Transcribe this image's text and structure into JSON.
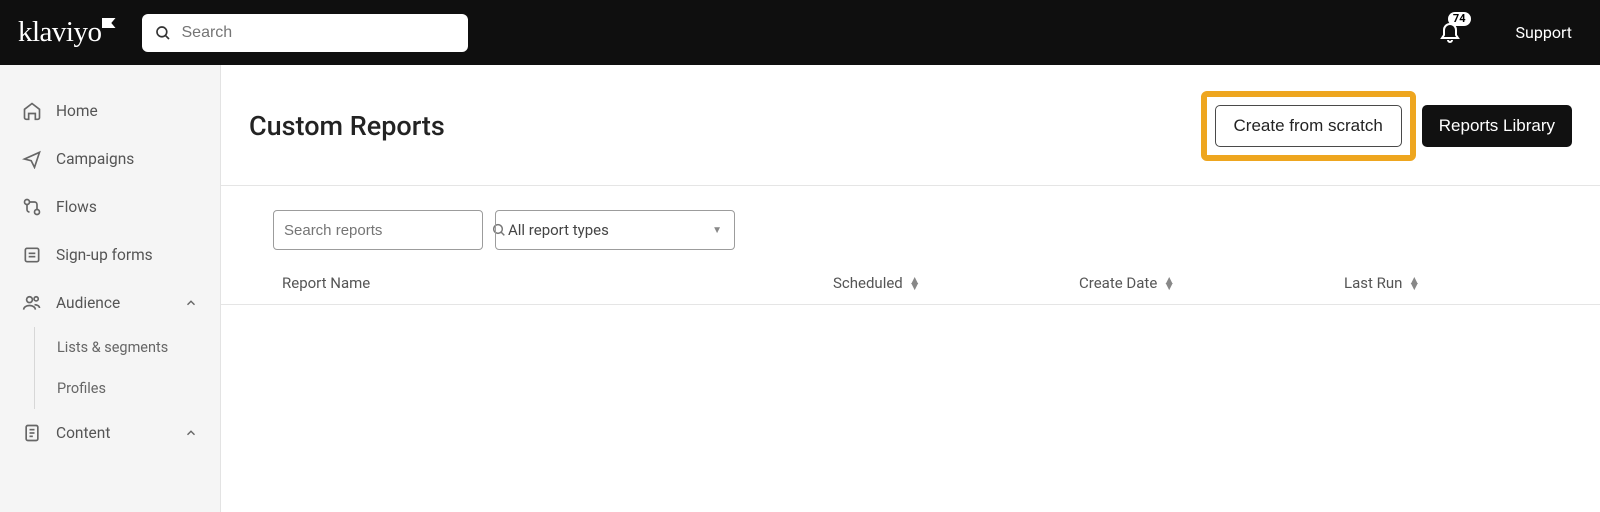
{
  "header": {
    "brand": "klaviyo",
    "search_placeholder": "Search",
    "notification_count": "74",
    "support_label": "Support"
  },
  "sidebar": {
    "items": [
      {
        "label": "Home"
      },
      {
        "label": "Campaigns"
      },
      {
        "label": "Flows"
      },
      {
        "label": "Sign-up forms"
      },
      {
        "label": "Audience",
        "expanded": true,
        "children": [
          {
            "label": "Lists & segments"
          },
          {
            "label": "Profiles"
          }
        ]
      },
      {
        "label": "Content",
        "expanded": true
      }
    ]
  },
  "page": {
    "title": "Custom Reports",
    "create_button": "Create from scratch",
    "library_button": "Reports Library"
  },
  "filters": {
    "search_placeholder": "Search reports",
    "type_select": "All report types"
  },
  "table": {
    "columns": {
      "name": "Report Name",
      "scheduled": "Scheduled",
      "create_date": "Create Date",
      "last_run": "Last Run"
    }
  }
}
